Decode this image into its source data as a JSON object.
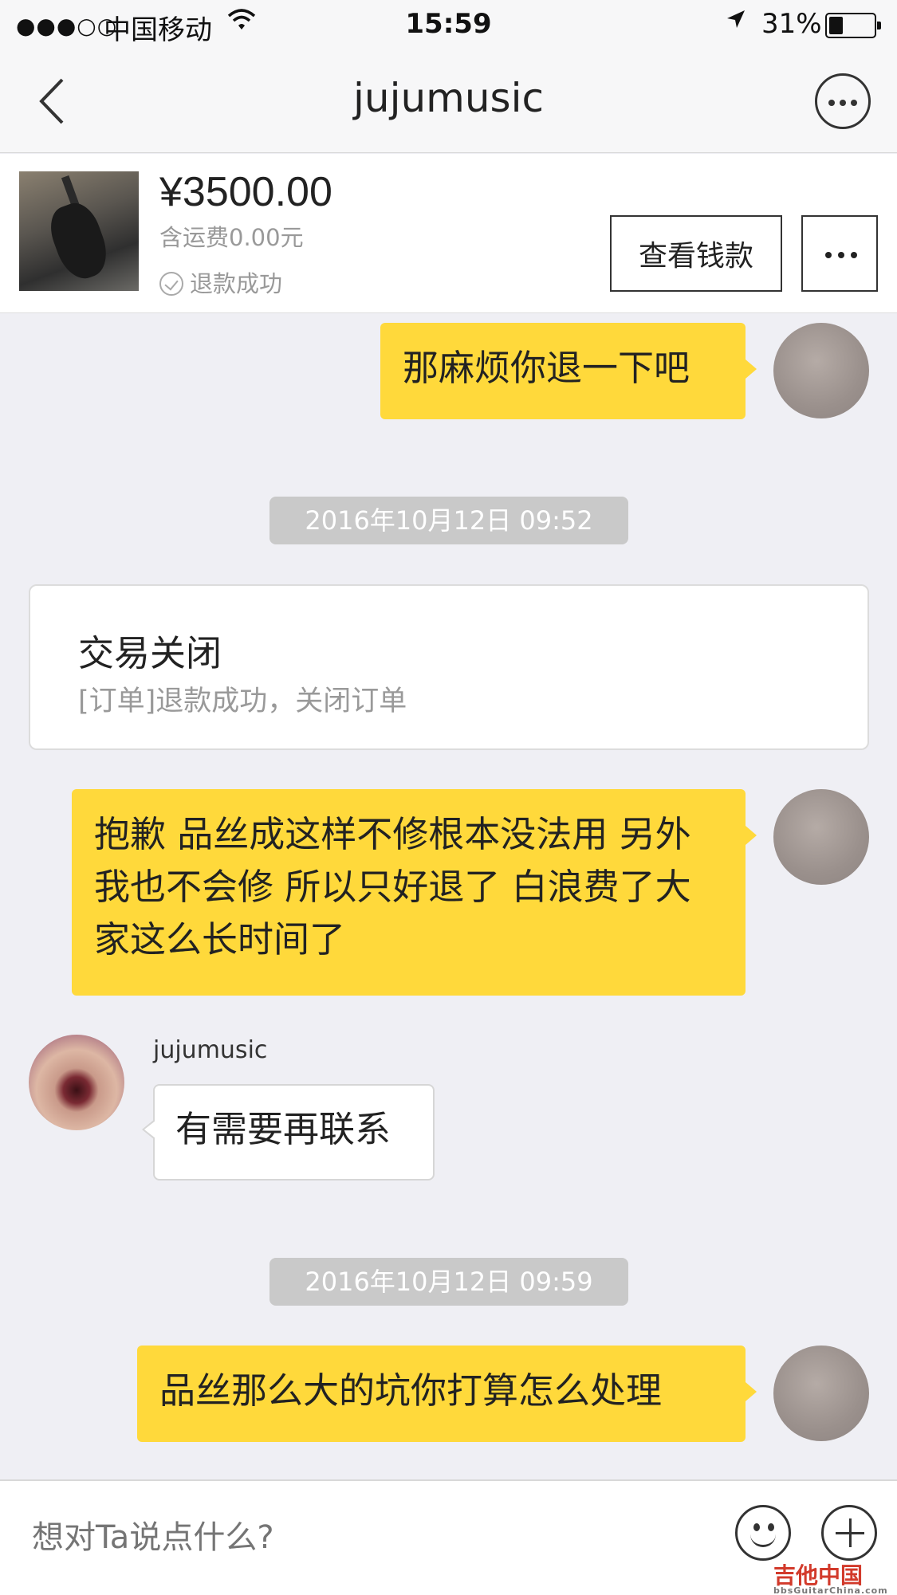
{
  "status_bar": {
    "signal": "●●●○○",
    "carrier": "中国移动",
    "time": "15:59",
    "battery_percent": "31%",
    "battery_level": 0.31
  },
  "nav": {
    "title": "jujumusic",
    "back_icon": "chevron-left-icon",
    "more_icon": "more-circle-icon"
  },
  "order": {
    "price": "¥3500.00",
    "shipping": "含运费0.00元",
    "status": "退款成功",
    "view_button": "查看钱款"
  },
  "messages": [
    {
      "type": "outgoing",
      "text": "那麻烦你退一下吧"
    },
    {
      "type": "timestamp",
      "text": "2016年10月12日 09:52"
    },
    {
      "type": "system",
      "title": "交易关闭",
      "subtitle": "[订单]退款成功，关闭订单"
    },
    {
      "type": "outgoing",
      "text": "抱歉 品丝成这样不修根本没法用 另外我也不会修 所以只好退了 白浪费了大家这么长时间了"
    },
    {
      "type": "incoming",
      "sender": "jujumusic",
      "text": "有需要再联系"
    },
    {
      "type": "timestamp",
      "text": "2016年10月12日 09:59"
    },
    {
      "type": "outgoing",
      "text": "品丝那么大的坑你打算怎么处理"
    }
  ],
  "input_bar": {
    "placeholder": "想对Ta说点什么?",
    "emoji_icon": "smiley-icon",
    "plus_icon": "plus-circle-icon"
  },
  "watermark": {
    "text": "吉他中国",
    "sub": "bbsGuitarChina.com"
  },
  "colors": {
    "accent_bubble": "#ffd93b",
    "background": "#efeff4",
    "timestamp_bg": "#c9c9c9"
  }
}
